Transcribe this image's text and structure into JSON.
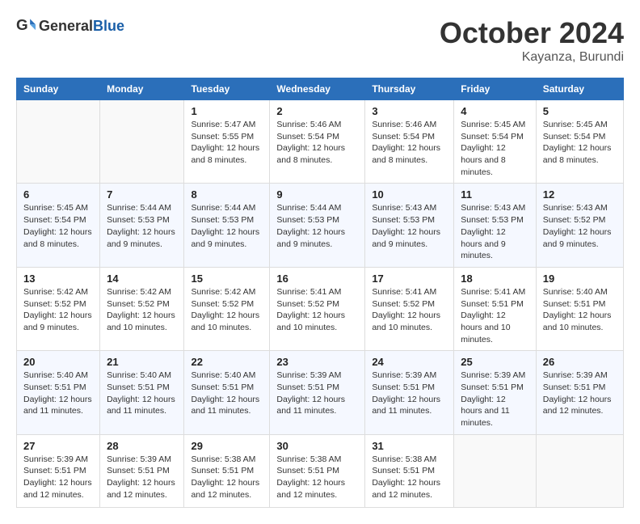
{
  "logo": {
    "text_general": "General",
    "text_blue": "Blue"
  },
  "header": {
    "month_title": "October 2024",
    "subtitle": "Kayanza, Burundi"
  },
  "days_of_week": [
    "Sunday",
    "Monday",
    "Tuesday",
    "Wednesday",
    "Thursday",
    "Friday",
    "Saturday"
  ],
  "weeks": [
    [
      {
        "day": "",
        "sunrise": "",
        "sunset": "",
        "daylight": ""
      },
      {
        "day": "",
        "sunrise": "",
        "sunset": "",
        "daylight": ""
      },
      {
        "day": "1",
        "sunrise": "Sunrise: 5:47 AM",
        "sunset": "Sunset: 5:55 PM",
        "daylight": "Daylight: 12 hours and 8 minutes."
      },
      {
        "day": "2",
        "sunrise": "Sunrise: 5:46 AM",
        "sunset": "Sunset: 5:54 PM",
        "daylight": "Daylight: 12 hours and 8 minutes."
      },
      {
        "day": "3",
        "sunrise": "Sunrise: 5:46 AM",
        "sunset": "Sunset: 5:54 PM",
        "daylight": "Daylight: 12 hours and 8 minutes."
      },
      {
        "day": "4",
        "sunrise": "Sunrise: 5:45 AM",
        "sunset": "Sunset: 5:54 PM",
        "daylight": "Daylight: 12 hours and 8 minutes."
      },
      {
        "day": "5",
        "sunrise": "Sunrise: 5:45 AM",
        "sunset": "Sunset: 5:54 PM",
        "daylight": "Daylight: 12 hours and 8 minutes."
      }
    ],
    [
      {
        "day": "6",
        "sunrise": "Sunrise: 5:45 AM",
        "sunset": "Sunset: 5:54 PM",
        "daylight": "Daylight: 12 hours and 8 minutes."
      },
      {
        "day": "7",
        "sunrise": "Sunrise: 5:44 AM",
        "sunset": "Sunset: 5:53 PM",
        "daylight": "Daylight: 12 hours and 9 minutes."
      },
      {
        "day": "8",
        "sunrise": "Sunrise: 5:44 AM",
        "sunset": "Sunset: 5:53 PM",
        "daylight": "Daylight: 12 hours and 9 minutes."
      },
      {
        "day": "9",
        "sunrise": "Sunrise: 5:44 AM",
        "sunset": "Sunset: 5:53 PM",
        "daylight": "Daylight: 12 hours and 9 minutes."
      },
      {
        "day": "10",
        "sunrise": "Sunrise: 5:43 AM",
        "sunset": "Sunset: 5:53 PM",
        "daylight": "Daylight: 12 hours and 9 minutes."
      },
      {
        "day": "11",
        "sunrise": "Sunrise: 5:43 AM",
        "sunset": "Sunset: 5:53 PM",
        "daylight": "Daylight: 12 hours and 9 minutes."
      },
      {
        "day": "12",
        "sunrise": "Sunrise: 5:43 AM",
        "sunset": "Sunset: 5:52 PM",
        "daylight": "Daylight: 12 hours and 9 minutes."
      }
    ],
    [
      {
        "day": "13",
        "sunrise": "Sunrise: 5:42 AM",
        "sunset": "Sunset: 5:52 PM",
        "daylight": "Daylight: 12 hours and 9 minutes."
      },
      {
        "day": "14",
        "sunrise": "Sunrise: 5:42 AM",
        "sunset": "Sunset: 5:52 PM",
        "daylight": "Daylight: 12 hours and 10 minutes."
      },
      {
        "day": "15",
        "sunrise": "Sunrise: 5:42 AM",
        "sunset": "Sunset: 5:52 PM",
        "daylight": "Daylight: 12 hours and 10 minutes."
      },
      {
        "day": "16",
        "sunrise": "Sunrise: 5:41 AM",
        "sunset": "Sunset: 5:52 PM",
        "daylight": "Daylight: 12 hours and 10 minutes."
      },
      {
        "day": "17",
        "sunrise": "Sunrise: 5:41 AM",
        "sunset": "Sunset: 5:52 PM",
        "daylight": "Daylight: 12 hours and 10 minutes."
      },
      {
        "day": "18",
        "sunrise": "Sunrise: 5:41 AM",
        "sunset": "Sunset: 5:51 PM",
        "daylight": "Daylight: 12 hours and 10 minutes."
      },
      {
        "day": "19",
        "sunrise": "Sunrise: 5:40 AM",
        "sunset": "Sunset: 5:51 PM",
        "daylight": "Daylight: 12 hours and 10 minutes."
      }
    ],
    [
      {
        "day": "20",
        "sunrise": "Sunrise: 5:40 AM",
        "sunset": "Sunset: 5:51 PM",
        "daylight": "Daylight: 12 hours and 11 minutes."
      },
      {
        "day": "21",
        "sunrise": "Sunrise: 5:40 AM",
        "sunset": "Sunset: 5:51 PM",
        "daylight": "Daylight: 12 hours and 11 minutes."
      },
      {
        "day": "22",
        "sunrise": "Sunrise: 5:40 AM",
        "sunset": "Sunset: 5:51 PM",
        "daylight": "Daylight: 12 hours and 11 minutes."
      },
      {
        "day": "23",
        "sunrise": "Sunrise: 5:39 AM",
        "sunset": "Sunset: 5:51 PM",
        "daylight": "Daylight: 12 hours and 11 minutes."
      },
      {
        "day": "24",
        "sunrise": "Sunrise: 5:39 AM",
        "sunset": "Sunset: 5:51 PM",
        "daylight": "Daylight: 12 hours and 11 minutes."
      },
      {
        "day": "25",
        "sunrise": "Sunrise: 5:39 AM",
        "sunset": "Sunset: 5:51 PM",
        "daylight": "Daylight: 12 hours and 11 minutes."
      },
      {
        "day": "26",
        "sunrise": "Sunrise: 5:39 AM",
        "sunset": "Sunset: 5:51 PM",
        "daylight": "Daylight: 12 hours and 12 minutes."
      }
    ],
    [
      {
        "day": "27",
        "sunrise": "Sunrise: 5:39 AM",
        "sunset": "Sunset: 5:51 PM",
        "daylight": "Daylight: 12 hours and 12 minutes."
      },
      {
        "day": "28",
        "sunrise": "Sunrise: 5:39 AM",
        "sunset": "Sunset: 5:51 PM",
        "daylight": "Daylight: 12 hours and 12 minutes."
      },
      {
        "day": "29",
        "sunrise": "Sunrise: 5:38 AM",
        "sunset": "Sunset: 5:51 PM",
        "daylight": "Daylight: 12 hours and 12 minutes."
      },
      {
        "day": "30",
        "sunrise": "Sunrise: 5:38 AM",
        "sunset": "Sunset: 5:51 PM",
        "daylight": "Daylight: 12 hours and 12 minutes."
      },
      {
        "day": "31",
        "sunrise": "Sunrise: 5:38 AM",
        "sunset": "Sunset: 5:51 PM",
        "daylight": "Daylight: 12 hours and 12 minutes."
      },
      {
        "day": "",
        "sunrise": "",
        "sunset": "",
        "daylight": ""
      },
      {
        "day": "",
        "sunrise": "",
        "sunset": "",
        "daylight": ""
      }
    ]
  ]
}
